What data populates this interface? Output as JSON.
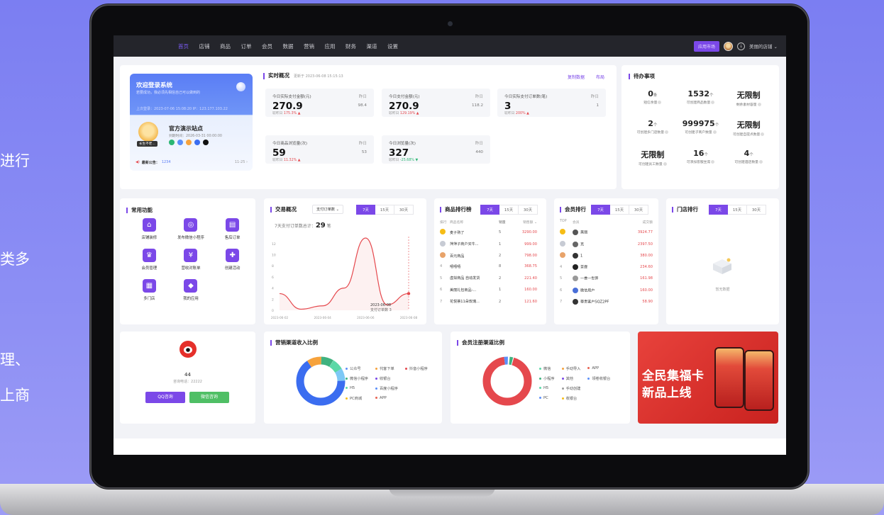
{
  "side_texts": [
    "进行",
    "类多",
    "理、",
    "上商"
  ],
  "nav": {
    "items": [
      "首页",
      "店铺",
      "商品",
      "订单",
      "会员",
      "数据",
      "营销",
      "应用",
      "财务",
      "渠道",
      "设置"
    ],
    "active": 0,
    "subscribe_btn": "应用市场",
    "shop_name": "美丽的店铺 ⌄"
  },
  "welcome": {
    "title": "欢迎登录系统",
    "subtitle": "若要成功，我必须先相信自己可以做到的",
    "login_info": "上次登录：2023-07-06 15:08:20  IP：123.177.103.22",
    "store_name": "官方演示站点",
    "expire": "到期时间：2026-03-31 00:00:00",
    "tag": "长生不老...",
    "notice_label": "最新公告：",
    "notice_value": "1234",
    "notice_date": "11-25  ›"
  },
  "realtime": {
    "title": "实时概况",
    "updated": "更新于 2023-06-08 15:15:13",
    "copy_link": "复制数据",
    "layout_link": "布局",
    "stats": [
      {
        "label": "今日实际支付金额(元)",
        "prev_label": "昨日",
        "value": "270.9",
        "prev_value": "98.4",
        "cmp_prefix": "较昨日 ",
        "cmp": "175.3% ▲",
        "trend": "up"
      },
      {
        "label": "今日支付金额(元)",
        "prev_label": "昨日",
        "value": "270.9",
        "prev_value": "118.2",
        "cmp_prefix": "较昨日 ",
        "cmp": "129.19% ▲",
        "trend": "up"
      },
      {
        "label": "今日实际支付订单数(笔)",
        "prev_label": "昨日",
        "value": "3",
        "prev_value": "1",
        "cmp_prefix": "较昨日 ",
        "cmp": "200% ▲",
        "trend": "up"
      },
      {
        "label": "今日商品浏览量(次)",
        "prev_label": "昨日",
        "value": "59",
        "prev_value": "53",
        "cmp_prefix": "较昨日 ",
        "cmp": "11.32% ▲",
        "trend": "up"
      },
      {
        "label": "今日浏览量(次)",
        "prev_label": "昨日",
        "value": "327",
        "prev_value": "440",
        "cmp_prefix": "较昨日 ",
        "cmp": "-25.68% ▼",
        "trend": "down"
      }
    ]
  },
  "todo": {
    "title": "待办事项",
    "items": [
      {
        "value": "0",
        "unit": "条",
        "label": "短信余量"
      },
      {
        "value": "1532",
        "unit": "个",
        "label": "可创建商品数量"
      },
      {
        "value": "无限制",
        "unit": "",
        "label": "剩余素材容量"
      },
      {
        "value": "2",
        "unit": "个",
        "label": "可创建多门店数量"
      },
      {
        "value": "999975",
        "unit": "个",
        "label": "可创建子商户数量"
      },
      {
        "value": "无限制",
        "unit": "",
        "label": "可创建自提点数量"
      },
      {
        "value": "无限制",
        "unit": "",
        "label": "可创建员工数量"
      },
      {
        "value": "16",
        "unit": "个",
        "label": "可添加客服坐席"
      },
      {
        "value": "4",
        "unit": "个",
        "label": "可创建酒店数量"
      }
    ]
  },
  "functions": {
    "title": "常用功能",
    "items": [
      {
        "label": "店铺装修",
        "icon": "brush-icon",
        "glyph": "⌂"
      },
      {
        "label": "发布微信小程序",
        "icon": "mini-program-icon",
        "glyph": "◎"
      },
      {
        "label": "售后订单",
        "icon": "after-sale-icon",
        "glyph": "▤"
      },
      {
        "label": "会员管理",
        "icon": "member-icon",
        "glyph": "♛"
      },
      {
        "label": "营收对账单",
        "icon": "bill-icon",
        "glyph": "¥"
      },
      {
        "label": "创建活动",
        "icon": "activity-icon",
        "glyph": "✚"
      },
      {
        "label": "多门店",
        "icon": "stores-icon",
        "glyph": "▦"
      },
      {
        "label": "我的应用",
        "icon": "apps-icon",
        "glyph": "◆"
      }
    ]
  },
  "trade": {
    "title": "交易概况",
    "select": "支付订单数  ⌄",
    "tabs": [
      "7天",
      "15天",
      "30天"
    ],
    "summary_label": "7天支付订单数总计：",
    "summary_value": "29",
    "summary_unit": "笔",
    "tooltip_date": "2023-06-08",
    "tooltip_text": "支付订单数  3"
  },
  "chart_data": {
    "type": "line",
    "x": [
      "2023-06-02",
      "2023-06-03",
      "2023-06-04",
      "2023-06-05",
      "2023-06-06",
      "2023-06-07",
      "2023-06-08"
    ],
    "x_tick_labels": [
      "2023-06-02",
      "2023-06-04",
      "2023-06-06",
      "2023-06-08"
    ],
    "series": [
      {
        "values": [
          3,
          0.2,
          0.8,
          4,
          13,
          1,
          3
        ]
      }
    ],
    "yticks": [
      "0",
      "2",
      "4",
      "6",
      "8",
      "10",
      "12"
    ],
    "ylim": [
      0,
      13
    ],
    "color": "#e5484d"
  },
  "goods_rank": {
    "title": "商品排行榜",
    "tabs": [
      "7天",
      "15天",
      "30天"
    ],
    "headers": [
      "排行",
      "商品名称",
      "销量",
      "销售额 ⌄"
    ],
    "rows": [
      {
        "rank": "1",
        "name": "麦子熟了",
        "sales": "5",
        "amount": "3290.00"
      },
      {
        "rank": "2",
        "name": "萍萍子商户买牛...",
        "sales": "1",
        "amount": "999.00"
      },
      {
        "rank": "3",
        "name": "百元商品",
        "sales": "2",
        "amount": "798.00"
      },
      {
        "rank": "4",
        "name": "嘻嘻嘻",
        "sales": "8",
        "amount": "368.75"
      },
      {
        "rank": "5",
        "name": "虚拟商品 自动发货",
        "sales": "2",
        "amount": "221.40"
      },
      {
        "rank": "6",
        "name": "美丽礼包商品-...",
        "sales": "1",
        "amount": "160.00"
      },
      {
        "rank": "7",
        "name": "花悦荟11朵玫瑰...",
        "sales": "2",
        "amount": "121.60"
      }
    ]
  },
  "member_rank": {
    "title": "会员排行",
    "tabs": [
      "7天",
      "15天",
      "30天"
    ],
    "headers": [
      "TOP",
      "会员",
      "成交额"
    ],
    "rows": [
      {
        "rank": "1",
        "name": "美丽",
        "amount": "3924.77"
      },
      {
        "rank": "2",
        "name": "克",
        "amount": "2397.50"
      },
      {
        "rank": "3",
        "name": "1",
        "amount": "380.00"
      },
      {
        "rank": "4",
        "name": "茶靡",
        "amount": "234.60"
      },
      {
        "rank": "5",
        "name": "一叁一世界",
        "amount": "161.98"
      },
      {
        "rank": "6",
        "name": "微信用户",
        "amount": "160.00"
      },
      {
        "rank": "7",
        "name": "尊贵客户SQZ2PF",
        "amount": "58.90"
      }
    ]
  },
  "store_rank": {
    "title": "门店排行",
    "tabs": [
      "7天",
      "15天",
      "30天"
    ],
    "empty": "暂无数据"
  },
  "consult": {
    "count": "44",
    "phone": "咨询电话：22222",
    "qq_btn": "QQ咨询",
    "wx_btn": "微信咨询"
  },
  "marketing_income": {
    "title": "营销渠道收入比例",
    "legend": [
      {
        "label": "公众号",
        "color": "#5b8ff9"
      },
      {
        "label": "代客下单",
        "color": "#f6a23c"
      },
      {
        "label": "抖音小程序",
        "color": "#e5484d"
      },
      {
        "label": "微信小程序",
        "color": "#3fb27f"
      },
      {
        "label": "收银台",
        "color": "#7b48e8"
      },
      {
        "label": "",
        "color": ""
      },
      {
        "label": "H5",
        "color": "#5ad8a6"
      },
      {
        "label": "百度小程序",
        "color": "#5b8ff9"
      },
      {
        "label": "",
        "color": ""
      },
      {
        "label": "PC商城",
        "color": "#f6bd16"
      },
      {
        "label": "APP",
        "color": "#e86452"
      }
    ]
  },
  "member_channel": {
    "title": "会员注册渠道比例",
    "legend": [
      {
        "label": "微信",
        "color": "#5ad8a6"
      },
      {
        "label": "手动导入",
        "color": "#f6a23c"
      },
      {
        "label": "APP",
        "color": "#e86452"
      },
      {
        "label": "小程序",
        "color": "#3fb27f"
      },
      {
        "label": "其他",
        "color": "#7b48e8"
      },
      {
        "label": "领卷收银台",
        "color": "#5b8ff9"
      },
      {
        "label": "H5",
        "color": "#5ad8a6"
      },
      {
        "label": "手动创建",
        "color": "#9b9b9b"
      },
      {
        "label": "",
        "color": ""
      },
      {
        "label": "PC",
        "color": "#5b8ff9"
      },
      {
        "label": "收银台",
        "color": "#f6bd16"
      }
    ]
  },
  "promo": {
    "line1": "全民集福卡",
    "line2": "新品上线"
  }
}
